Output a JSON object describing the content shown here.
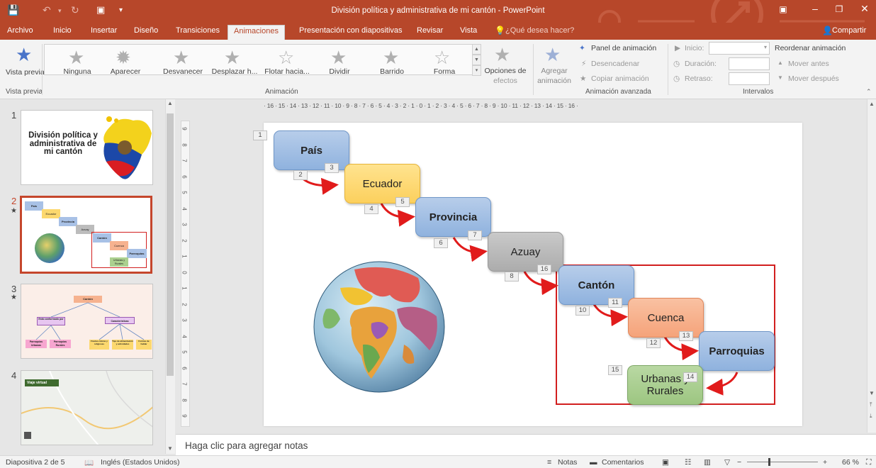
{
  "window": {
    "title": "División política y administrativa de mi cantón - PowerPoint",
    "save_icon": "save-icon",
    "undo_icon": "undo-icon",
    "redo_icon": "redo-icon"
  },
  "tabs": [
    {
      "label": "Archivo"
    },
    {
      "label": "Inicio"
    },
    {
      "label": "Insertar"
    },
    {
      "label": "Diseño"
    },
    {
      "label": "Transiciones"
    },
    {
      "label": "Animaciones",
      "active": true
    },
    {
      "label": "Presentación con diapositivas"
    },
    {
      "label": "Revisar"
    },
    {
      "label": "Vista"
    }
  ],
  "tell_me": "¿Qué desea hacer?",
  "share": "Compartir",
  "ribbon": {
    "preview": "Vista previa",
    "animations": [
      "Ninguna",
      "Aparecer",
      "Desvanecer",
      "Desplazar h...",
      "Flotar hacia...",
      "Dividir",
      "Barrido",
      "Forma"
    ],
    "effect_options": [
      "Opciones de",
      "efectos"
    ],
    "add_animation": [
      "Agregar",
      "animación"
    ],
    "animation_pane": "Panel de animación",
    "trigger": "Desencadenar",
    "painter": "Copiar animación",
    "start": "Inicio:",
    "duration": "Duración:",
    "delay": "Retraso:",
    "reorder": "Reordenar animación",
    "move_earlier": "Mover antes",
    "move_later": "Mover después",
    "groups": {
      "preview": "Vista previa",
      "animation": "Animación",
      "advanced": "Animación avanzada",
      "timing": "Intervalos"
    }
  },
  "colors": {
    "accent": "#b7472a",
    "selection": "#c5462c",
    "highlight_rect": "#d21f1f"
  },
  "thumbnails": [
    {
      "number": "1",
      "title": "División política y administrativa de mi cantón"
    },
    {
      "number": "2",
      "labels": [
        "País",
        "Ecuador",
        "Provincia",
        "Azuay",
        "Cantón",
        "Cuenca",
        "Parroquias",
        "Urbanas y Rurales"
      ]
    },
    {
      "number": "3",
      "labels": [
        "Cantón",
        "Está conformado por",
        "Características",
        "Parroquias Urbanas",
        "Parroquias Rurales",
        "Fiestas cívicas y religiosas",
        "Tipo de alimentación y actividades",
        "Formas de hablar"
      ]
    },
    {
      "number": "4",
      "labels": [
        "Viaje virtual"
      ]
    }
  ],
  "ruler": {
    "horizontal": "· 16 · 15 · 14 · 13 · 12 · 11 · 10 · 9 · 8 · 7 · 6 · 5 · 4 · 3 · 2 · 1 · 0 · 1 · 2 · 3 · 4 · 5 · 6 · 7 · 8 · 9 · 10 · 11 · 12 · 13 · 14 · 15 · 16 ·",
    "vertical": [
      "9",
      "8",
      "7",
      "6",
      "5",
      "4",
      "3",
      "2",
      "1",
      "0",
      "1",
      "2",
      "3",
      "4",
      "5",
      "6",
      "7",
      "8",
      "9"
    ]
  },
  "slide": {
    "boxes": {
      "pais": "País",
      "ecuador": "Ecuador",
      "provincia": "Provincia",
      "azuay": "Azuay",
      "canton": "Cantón",
      "cuenca": "Cuenca",
      "parroquias": "Parroquias",
      "urbanas": "Urbanas y\nRurales"
    },
    "tags": [
      "1",
      "2",
      "3",
      "4",
      "5",
      "6",
      "7",
      "8",
      "16",
      "10",
      "11",
      "12",
      "13",
      "15",
      "14"
    ]
  },
  "notes_placeholder": "Haga clic para agregar notas",
  "status": {
    "slide": "Diapositiva 2 de 5",
    "language": "Inglés (Estados Unidos)",
    "notes": "Notas",
    "comments": "Comentarios",
    "zoom": "66 %",
    "zoom_level": 0.66
  }
}
